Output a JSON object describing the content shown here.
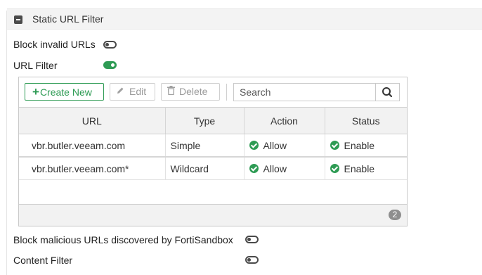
{
  "section": {
    "title": "Static URL Filter"
  },
  "block_invalid_urls": {
    "label": "Block invalid URLs",
    "enabled": false
  },
  "url_filter": {
    "label": "URL Filter",
    "enabled": true
  },
  "toolbar": {
    "create_new_label": "Create New",
    "edit_label": "Edit",
    "delete_label": "Delete"
  },
  "search": {
    "placeholder": "Search"
  },
  "table": {
    "columns": [
      "URL",
      "Type",
      "Action",
      "Status"
    ],
    "rows": [
      {
        "url": "vbr.butler.veeam.com",
        "type": "Simple",
        "action": "Allow",
        "status": "Enable"
      },
      {
        "url": "vbr.butler.veeam.com*",
        "type": "Wildcard",
        "action": "Allow",
        "status": "Enable"
      }
    ],
    "count": "2"
  },
  "block_malicious": {
    "label": "Block malicious URLs discovered by FortiSandbox",
    "enabled": false
  },
  "content_filter": {
    "label": "Content Filter",
    "enabled": false
  },
  "colors": {
    "accent_green": "#2e9b54",
    "toggle_off": "#4a4a4a"
  },
  "icons": {
    "collapse": "minus-square-icon",
    "create": "plus-icon",
    "edit": "pencil-icon",
    "delete": "trash-icon",
    "search": "magnifier-icon",
    "status": "check-circle-icon"
  }
}
